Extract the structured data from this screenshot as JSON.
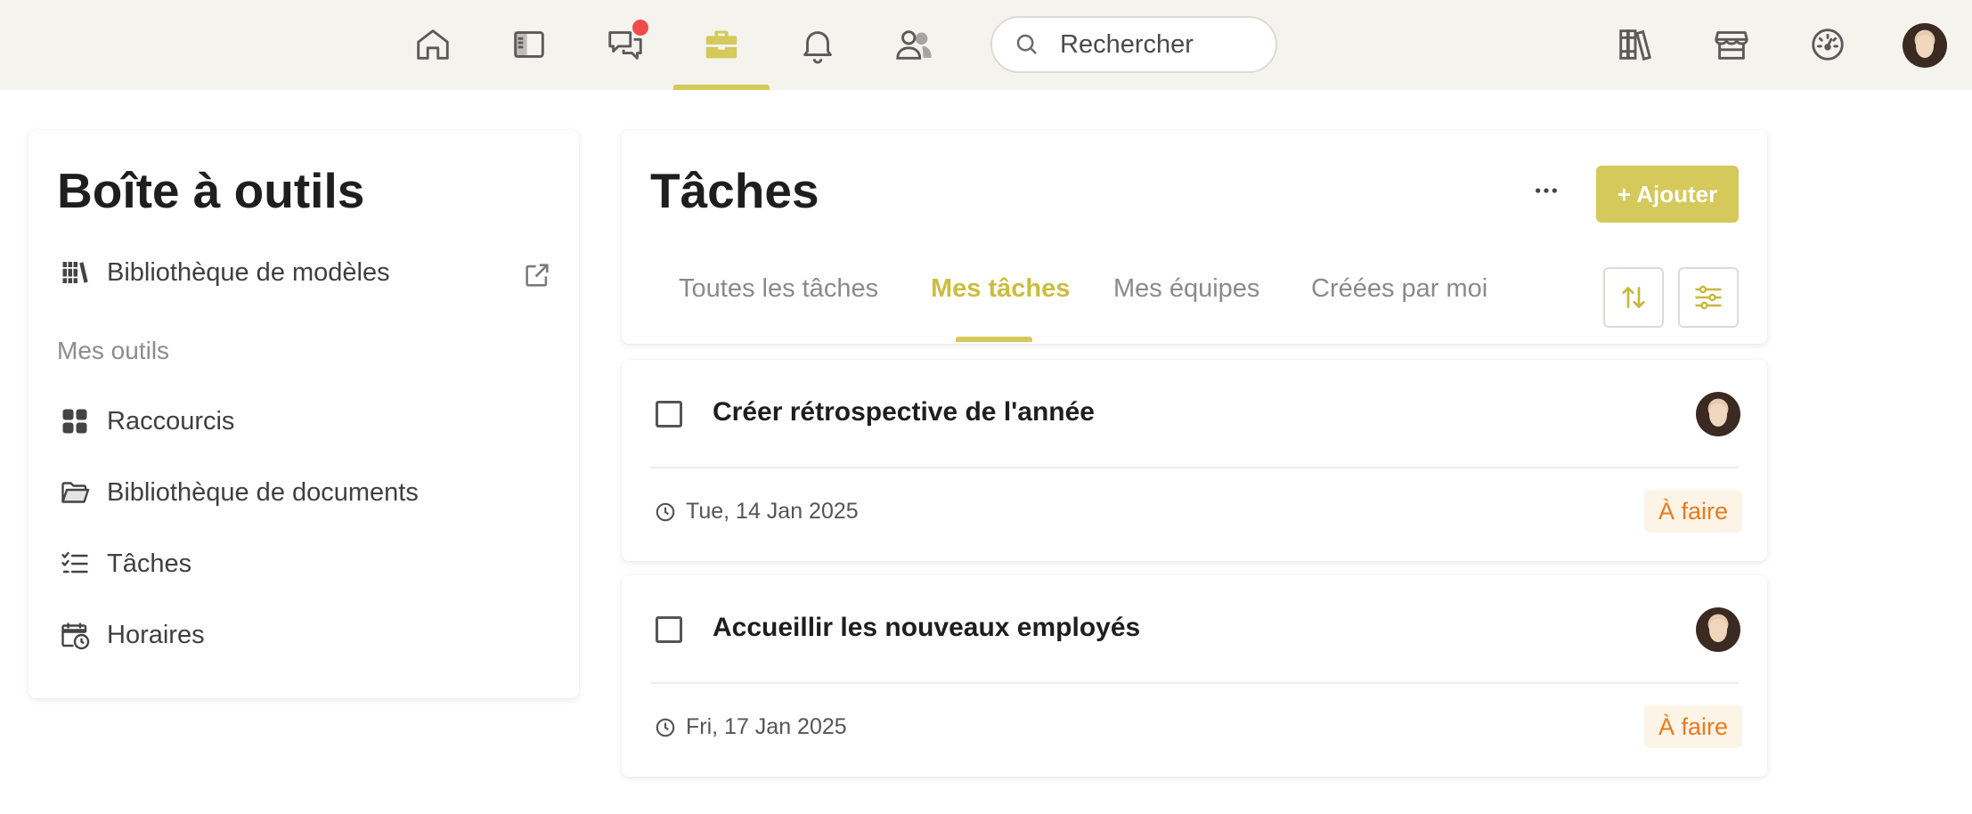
{
  "topbar": {
    "nav": [
      {
        "icon": "home-icon"
      },
      {
        "icon": "sidebar-panel-icon"
      },
      {
        "icon": "chat-icon",
        "has_notification": true
      },
      {
        "icon": "briefcase-icon",
        "active": true
      },
      {
        "icon": "bell-icon"
      },
      {
        "icon": "people-icon"
      }
    ],
    "search_placeholder": "Rechercher",
    "right_icons": [
      "library-icon",
      "store-icon",
      "dashboard-gauge-icon"
    ],
    "accent_color": "#d4c95a",
    "notification_color": "#ef4b4b"
  },
  "sidebar": {
    "title": "Boîte à outils",
    "template_library": "Bibliothèque de modèles",
    "section_label": "Mes outils",
    "items": [
      {
        "label": "Raccourcis",
        "icon": "grid-icon"
      },
      {
        "label": "Bibliothèque de documents",
        "icon": "folder-open-icon"
      },
      {
        "label": "Tâches",
        "icon": "checklist-icon"
      },
      {
        "label": "Horaires",
        "icon": "calendar-clock-icon"
      }
    ]
  },
  "main": {
    "title": "Tâches",
    "more_label": "•••",
    "add_label": "+ Ajouter",
    "tabs": [
      {
        "label": "Toutes les tâches",
        "active": false
      },
      {
        "label": "Mes tâches",
        "active": true
      },
      {
        "label": "Mes équipes",
        "active": false
      },
      {
        "label": "Créées par moi",
        "active": false
      }
    ]
  },
  "tasks": [
    {
      "title": "Créer rétrospective de l'année",
      "date": "Tue, 14 Jan 2025",
      "status": "À faire",
      "checked": false
    },
    {
      "title": "Accueillir les nouveaux employés",
      "date": "Fri, 17 Jan 2025",
      "status": "À faire",
      "checked": false
    }
  ]
}
